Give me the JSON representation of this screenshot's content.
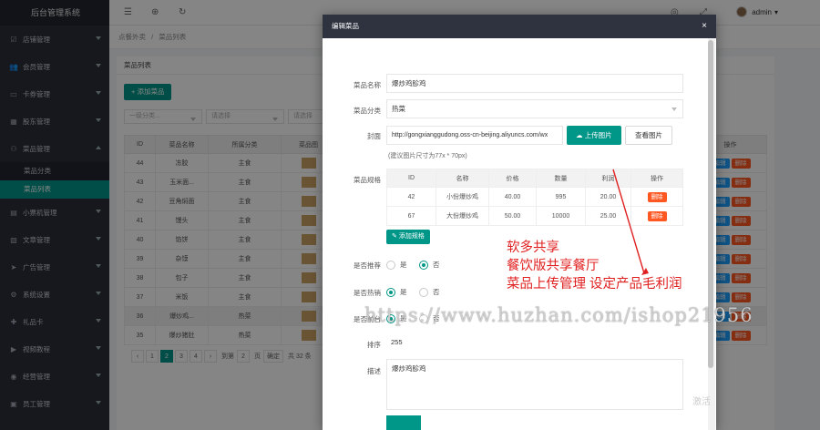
{
  "sidebar": {
    "title": "后台管理系统",
    "items": [
      {
        "label": "店铺管理",
        "icon": "check-square-icon"
      },
      {
        "label": "会员管理",
        "icon": "users-icon"
      },
      {
        "label": "卡券管理",
        "icon": "card-icon"
      },
      {
        "label": "股东管理",
        "icon": "building-icon"
      },
      {
        "label": "菜品管理",
        "icon": "bicycle-icon"
      },
      {
        "label": "小票机管理",
        "icon": "printer-icon"
      },
      {
        "label": "文章管理",
        "icon": "document-icon"
      },
      {
        "label": "广告管理",
        "icon": "send-icon"
      },
      {
        "label": "系统设置",
        "icon": "gear-icon"
      },
      {
        "label": "礼品卡",
        "icon": "gift-icon"
      },
      {
        "label": "视频教程",
        "icon": "video-icon"
      },
      {
        "label": "经营管理",
        "icon": "chart-icon"
      },
      {
        "label": "员工管理",
        "icon": "user-icon"
      }
    ],
    "sub": [
      "菜品分类",
      "菜品列表"
    ]
  },
  "topbar": {
    "user": "admin"
  },
  "breadcrumb": {
    "parent": "点餐外卖",
    "sep": "/",
    "current": "菜品列表"
  },
  "list": {
    "title": "菜品列表",
    "add_label": "+ 添加菜品",
    "filters": [
      "一级分类...",
      "请选择",
      "请选择"
    ],
    "columns": [
      "ID",
      "菜品名称",
      "所属分类",
      "菜品图"
    ],
    "action_header": "操作",
    "rows": [
      [
        "44",
        "冻胶",
        "主食"
      ],
      [
        "43",
        "玉米面...",
        "主食"
      ],
      [
        "42",
        "豆角焖面",
        "主食"
      ],
      [
        "41",
        "馒头",
        "主食"
      ],
      [
        "40",
        "馅饼",
        "主食"
      ],
      [
        "39",
        "杂馍",
        "主食"
      ],
      [
        "38",
        "包子",
        "主食"
      ],
      [
        "37",
        "米饭",
        "主食"
      ],
      [
        "36",
        "爆炒鸡...",
        "热菜"
      ],
      [
        "35",
        "爆炒猪肚",
        "热菜"
      ]
    ],
    "edit_label": "编辑",
    "del_label": "删除",
    "pager": {
      "prev": "‹",
      "pages": [
        "1",
        "2",
        "3",
        "4"
      ],
      "next": "›",
      "goto": "到第",
      "page_input": "2",
      "page_unit": "页",
      "confirm": "确定",
      "total": "共 32 条"
    }
  },
  "modal": {
    "title": "编辑菜品",
    "close": "×",
    "name_label": "菜品名称",
    "name_value": "爆炒鸡胗鸡",
    "cat_label": "菜品分类",
    "cat_value": "热菜",
    "cover_label": "封面",
    "cover_value": "http://gongxianggudong.oss-cn-beijing.aliyuncs.com/wx",
    "upload_label": "上传图片",
    "view_label": "查看图片",
    "hint": "(建议图片尺寸为77x * 70px)",
    "spec_label": "菜品规格",
    "spec_columns": [
      "ID",
      "名称",
      "价格",
      "数量",
      "利润",
      "操作"
    ],
    "spec_rows": [
      [
        "42",
        "小份爆炒鸡",
        "40.00",
        "995",
        "20.00"
      ],
      [
        "67",
        "大份爆炒鸡",
        "50.00",
        "10000",
        "25.00"
      ]
    ],
    "spec_del": "删除",
    "add_spec_label": "添加规格",
    "recommend_label": "是否推荐",
    "hot_label": "是否热销",
    "shelf_label": "是否前台",
    "yes": "是",
    "no": "否",
    "sort_label": "排序",
    "sort_value": "255",
    "desc_label": "描述",
    "desc_value": "爆炒鸡胗鸡"
  },
  "annotation": {
    "lines": [
      "软多共享",
      "餐饮版共享餐厅",
      "菜品上传管理  设定产品毛利润"
    ],
    "watermark": "https://www.huzhan.com/ishop21956",
    "corner": "激活"
  }
}
